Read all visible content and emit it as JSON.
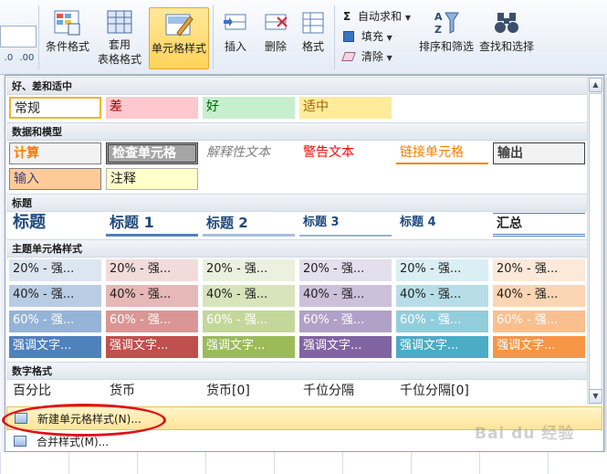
{
  "ribbon": {
    "num_labels": [
      ".0",
      ".00"
    ],
    "conditional_format": "条件格式",
    "table_format_line1": "套用",
    "table_format_line2": "表格格式",
    "cell_styles": "单元格样式",
    "insert": "插入",
    "delete": "删除",
    "format": "格式",
    "autosum": "自动求和",
    "fill": "填充",
    "clear": "清除",
    "sort_filter": "排序和筛选",
    "find_select": "查找和选择",
    "sigma": "Σ"
  },
  "gallery": {
    "sections": {
      "good_bad": "好、差和适中",
      "data_model": "数据和模型",
      "titles": "标题",
      "theme": "主题单元格样式",
      "number": "数字格式"
    },
    "good_bad": [
      "常规",
      "差",
      "好",
      "适中"
    ],
    "data_model_row1": [
      "计算",
      "检查单元格",
      "解释性文本",
      "警告文本",
      "链接单元格",
      "输出"
    ],
    "data_model_row2": [
      "输入",
      "注释"
    ],
    "titles": [
      "标题",
      "标题 1",
      "标题 2",
      "标题 3",
      "标题 4",
      "汇总"
    ],
    "theme_rows": [
      [
        "20% - 强...",
        "20% - 强...",
        "20% - 强...",
        "20% - 强...",
        "20% - 强...",
        "20% - 强..."
      ],
      [
        "40% - 强...",
        "40% - 强...",
        "40% - 强...",
        "40% - 强...",
        "40% - 强...",
        "40% - 强..."
      ],
      [
        "60% - 强...",
        "60% - 强...",
        "60% - 强...",
        "60% - 强...",
        "60% - 强...",
        "60% - 强..."
      ],
      [
        "强调文字...",
        "强调文字...",
        "强调文字...",
        "强调文字...",
        "强调文字...",
        "强调文字..."
      ]
    ],
    "number_formats": [
      "百分比",
      "货币",
      "货币[0]",
      "千位分隔",
      "千位分隔[0]"
    ]
  },
  "menu": {
    "new_style": "新建单元格样式(N)...",
    "merge_style": "合并样式(M)..."
  },
  "watermark": "Bai du 经验",
  "colors": {
    "accent_20": [
      "#dce6f1",
      "#f2dcdb",
      "#ebf1de",
      "#e4dfec",
      "#daeef3",
      "#fde9d9"
    ],
    "accent_40": [
      "#b8cce4",
      "#e6b8b7",
      "#d8e4bc",
      "#ccc0da",
      "#b7dee8",
      "#fcd5b4"
    ],
    "accent_60": [
      "#95b3d7",
      "#da9694",
      "#c4d79b",
      "#b1a0c7",
      "#92cddc",
      "#fabf8f"
    ],
    "accent_100": [
      "#4f81bd",
      "#c0504d",
      "#9bbb59",
      "#8064a2",
      "#4bacc6",
      "#f79646"
    ],
    "highlight_circle": "#e0101a"
  }
}
